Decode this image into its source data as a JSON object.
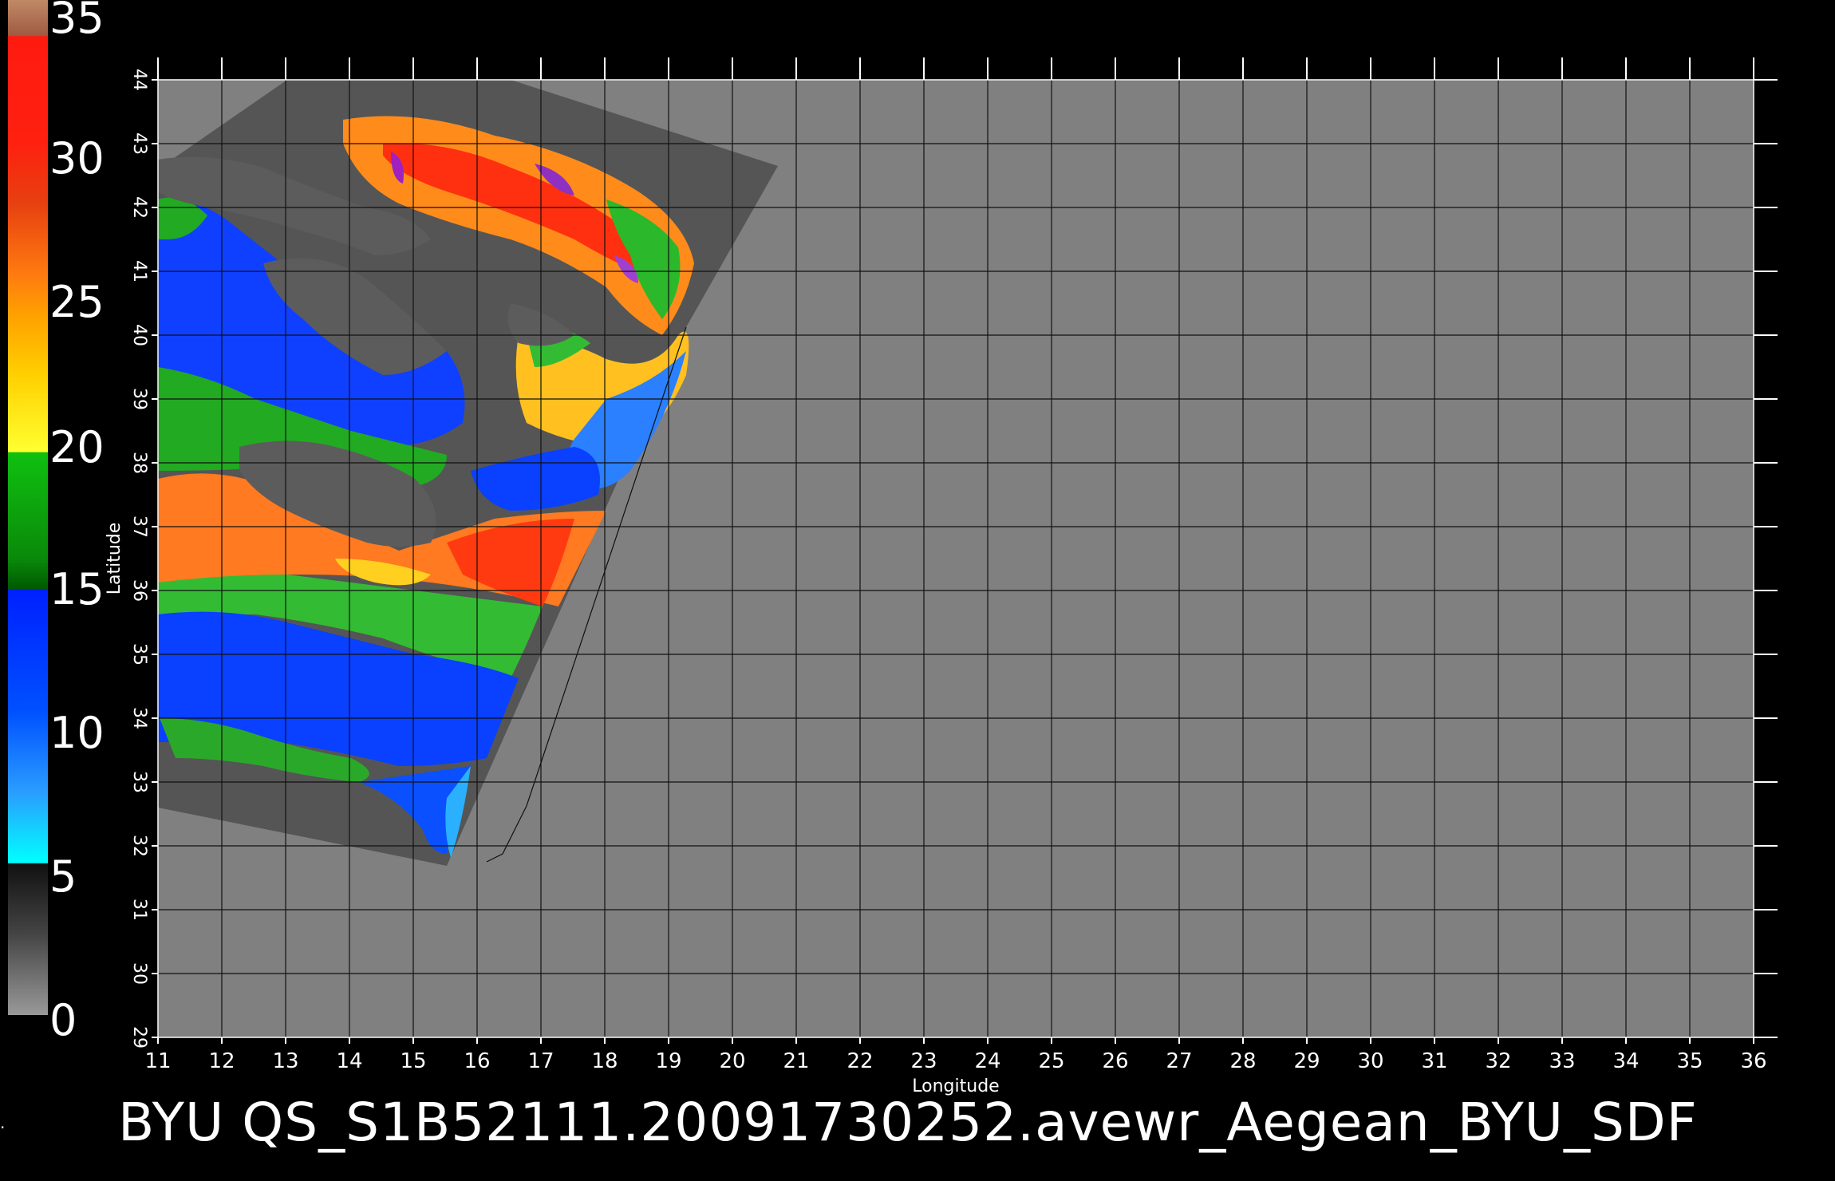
{
  "colorbar": {
    "labels": [
      "35",
      "30",
      "25",
      "20",
      "15",
      "10",
      "5",
      "0"
    ],
    "colors": {
      "top": "#b87a55",
      "red": "#ff1010",
      "orange": "#ff7a10",
      "yellow": "#ffe000",
      "green": "#10c010",
      "dark_green": "#006600",
      "blue": "#0030ff",
      "light_blue": "#2a9cff",
      "cyan": "#00ffff",
      "gray_dark": "#222222",
      "gray_light": "#888888"
    }
  },
  "map": {
    "x_axis_label": "Longitude",
    "y_axis_label": "Latitude",
    "lon_ticks": [
      "11",
      "12",
      "13",
      "14",
      "15",
      "16",
      "17",
      "18",
      "19",
      "20",
      "21",
      "22",
      "23",
      "24",
      "25",
      "26",
      "27",
      "28",
      "29",
      "30",
      "31",
      "32",
      "33",
      "34",
      "35",
      "36"
    ],
    "lat_ticks": [
      "44",
      "43",
      "42",
      "41",
      "40",
      "39",
      "38",
      "37",
      "36",
      "35",
      "34",
      "33",
      "32",
      "31",
      "30",
      "29"
    ],
    "background_color": "#808080",
    "swath_mask_color": "#555555",
    "land_color": "#5c5c5c"
  },
  "caption": "BYU  QS_S1B52111.20091730252.avewr_Aegean_BYU_SDF",
  "side_mark": "."
}
